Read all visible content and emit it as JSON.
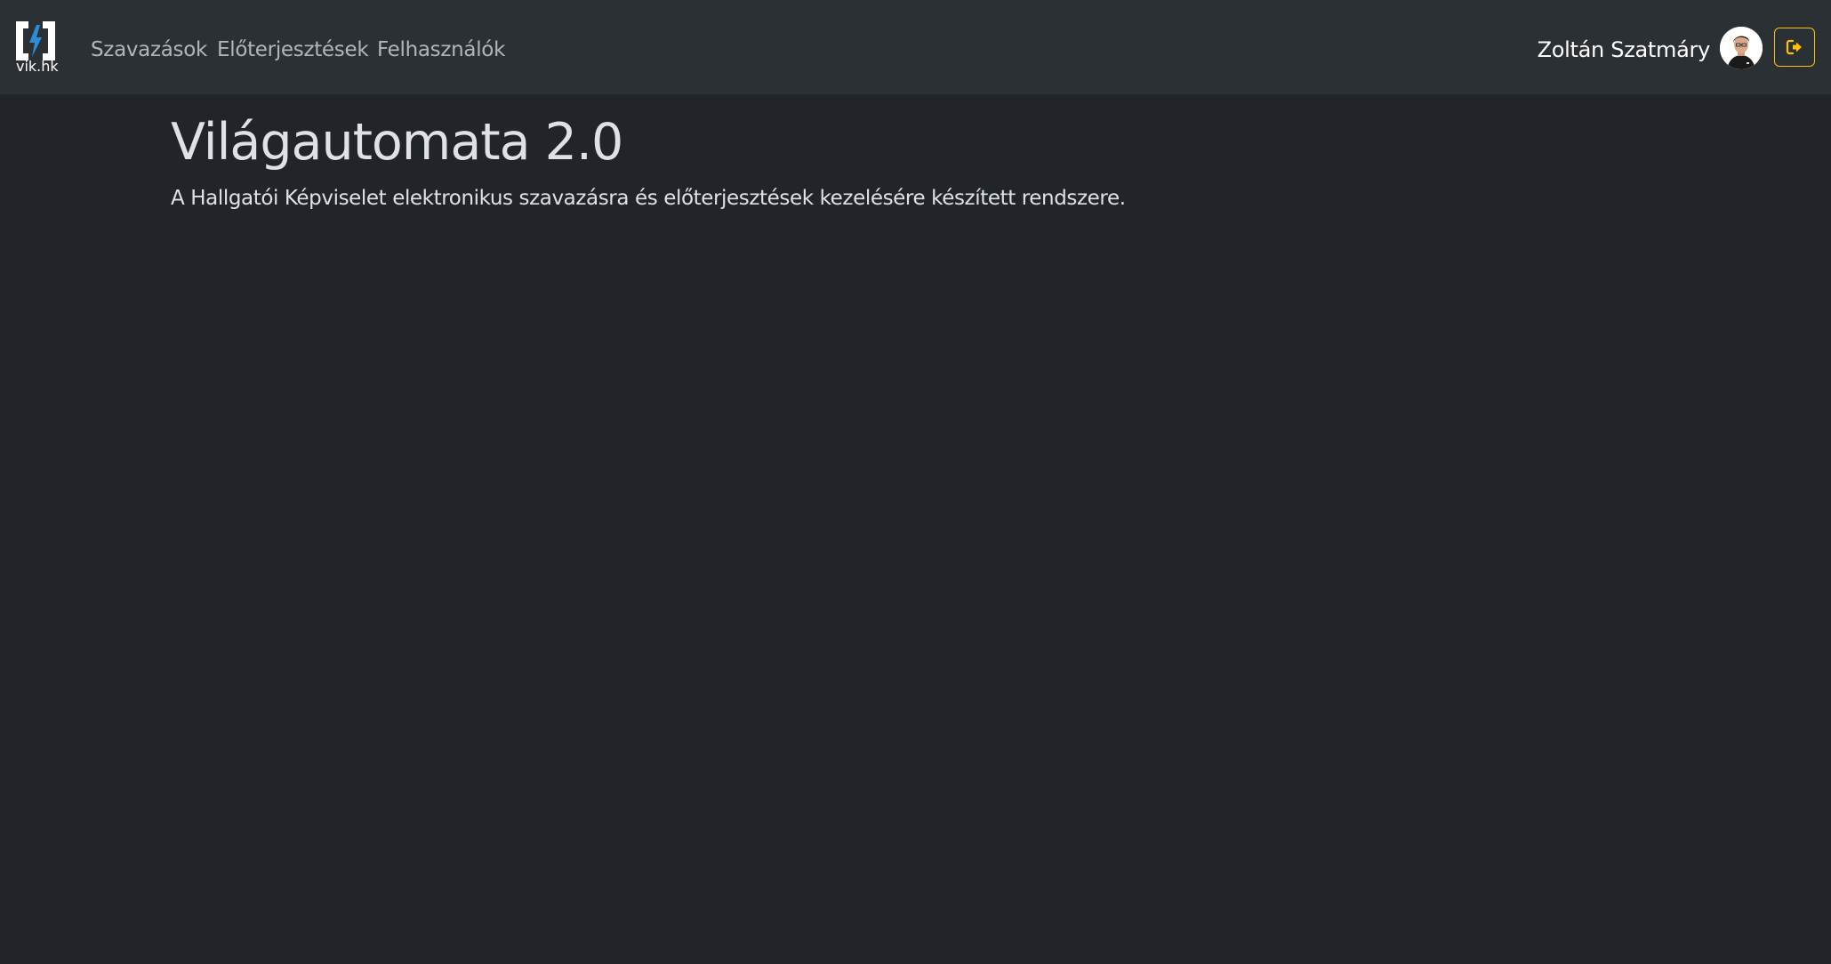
{
  "brand": {
    "logo_text": "vik.hk",
    "accent_color": "#2e8bd4"
  },
  "nav": {
    "items": [
      {
        "label": "Szavazások"
      },
      {
        "label": "Előterjesztések"
      },
      {
        "label": "Felhasználók"
      }
    ]
  },
  "user": {
    "name": "Zoltán Szatmáry",
    "avatar_icon": "user-avatar"
  },
  "logout": {
    "icon": "sign-out-icon",
    "color": "#ffc107"
  },
  "main": {
    "title": "Világautomata 2.0",
    "description": "A Hallgatói Képviselet elektronikus szavazásra és előterjesztések kezelésére készített rendszere."
  },
  "colors": {
    "background": "#212529",
    "navbar": "#2b3035"
  }
}
